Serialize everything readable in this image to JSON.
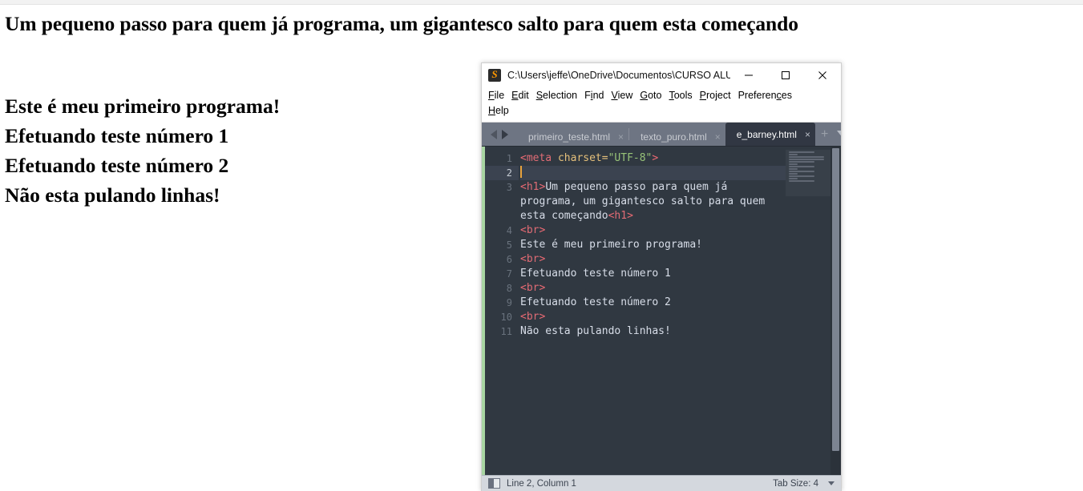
{
  "browser_page": {
    "heading": "Um pequeno passo para quem já programa, um gigantesco salto para quem esta começando",
    "lines": [
      "Este é meu primeiro programa!",
      "Efetuando teste número 1",
      "Efetuando teste número 2",
      "Não esta pulando linhas!"
    ]
  },
  "editor_window": {
    "app_icon": "sublime-text-icon",
    "title": "C:\\Users\\jeffe\\OneDrive\\Documentos\\CURSO ALU...",
    "window_controls": {
      "minimize": "minimize-icon",
      "maximize": "maximize-icon",
      "close": "close-icon"
    },
    "menu": [
      {
        "label": "File",
        "mnemonic_index": 0
      },
      {
        "label": "Edit",
        "mnemonic_index": 0
      },
      {
        "label": "Selection",
        "mnemonic_index": 0
      },
      {
        "label": "Find",
        "mnemonic_index": 1
      },
      {
        "label": "View",
        "mnemonic_index": 0
      },
      {
        "label": "Goto",
        "mnemonic_index": 0
      },
      {
        "label": "Tools",
        "mnemonic_index": 0
      },
      {
        "label": "Project",
        "mnemonic_index": 0
      },
      {
        "label": "Preferences",
        "mnemonic_index": 8
      },
      {
        "label": "Help",
        "mnemonic_index": 0
      }
    ],
    "tab_nav": {
      "prev": "arrow-left-icon",
      "next": "arrow-right-icon"
    },
    "tabs": [
      {
        "label": "primeiro_teste.html",
        "active": false,
        "close": "×"
      },
      {
        "label": "texto_puro.html",
        "active": false,
        "close": "×"
      },
      {
        "label": "e_barney.html",
        "active": true,
        "close": "×"
      }
    ],
    "tab_actions": {
      "new_tab": "+",
      "tab_menu": "chevron-down-icon"
    },
    "code": {
      "line_numbers": [
        "1",
        "2",
        "3",
        "4",
        "5",
        "6",
        "7",
        "8",
        "9",
        "10",
        "11"
      ],
      "lines": [
        {
          "n": "1",
          "tokens": [
            {
              "t": "<",
              "c": "punct"
            },
            {
              "t": "meta",
              "c": "tag"
            },
            {
              "t": " charset=",
              "c": "attr"
            },
            {
              "t": "\"UTF-8\"",
              "c": "str"
            },
            {
              "t": ">",
              "c": "punct"
            }
          ]
        },
        {
          "n": "2",
          "tokens": [],
          "current": true
        },
        {
          "n": "3",
          "tokens": [
            {
              "t": "<",
              "c": "punct"
            },
            {
              "t": "h1",
              "c": "tag"
            },
            {
              "t": ">",
              "c": "punct"
            },
            {
              "t": "Um pequeno passo para quem já",
              "c": "text"
            }
          ]
        },
        {
          "n": "3w",
          "wrap": true,
          "tokens": [
            {
              "t": "programa, um gigantesco salto para quem",
              "c": "text"
            }
          ]
        },
        {
          "n": "3w",
          "wrap": true,
          "tokens": [
            {
              "t": "esta começando",
              "c": "text"
            },
            {
              "t": "<",
              "c": "punct"
            },
            {
              "t": "h1",
              "c": "tag"
            },
            {
              "t": ">",
              "c": "punct"
            }
          ]
        },
        {
          "n": "4",
          "tokens": [
            {
              "t": "<",
              "c": "punct"
            },
            {
              "t": "br",
              "c": "tag"
            },
            {
              "t": ">",
              "c": "punct"
            }
          ]
        },
        {
          "n": "5",
          "tokens": [
            {
              "t": "Este é meu primeiro programa!",
              "c": "text"
            }
          ]
        },
        {
          "n": "6",
          "tokens": [
            {
              "t": "<",
              "c": "punct"
            },
            {
              "t": "br",
              "c": "tag"
            },
            {
              "t": ">",
              "c": "punct"
            }
          ]
        },
        {
          "n": "7",
          "tokens": [
            {
              "t": "Efetuando teste número 1",
              "c": "text"
            }
          ]
        },
        {
          "n": "8",
          "tokens": [
            {
              "t": "<",
              "c": "punct"
            },
            {
              "t": "br",
              "c": "tag"
            },
            {
              "t": ">",
              "c": "punct"
            }
          ]
        },
        {
          "n": "9",
          "tokens": [
            {
              "t": "Efetuando teste número 2",
              "c": "text"
            }
          ]
        },
        {
          "n": "10",
          "tokens": [
            {
              "t": "<",
              "c": "punct"
            },
            {
              "t": "br",
              "c": "tag"
            },
            {
              "t": ">",
              "c": "punct"
            }
          ]
        },
        {
          "n": "11",
          "tokens": [
            {
              "t": "Não esta pulando linhas!",
              "c": "text"
            }
          ]
        }
      ]
    },
    "status_bar": {
      "cursor_position": "Line 2, Column 1",
      "tab_size": "Tab Size: 4",
      "menu_caret": "chevron-down-icon"
    },
    "colors": {
      "editor_background": "#303841",
      "tab_bar": "#6e7583",
      "active_tab": "#313743",
      "accent_bar": "#a8d5a2",
      "cursor": "#e8a33d",
      "tag": "#e06c75",
      "string": "#98c379",
      "attribute": "#e5c07b",
      "text": "#d8dee9",
      "status_bar": "#d4d8de"
    }
  }
}
